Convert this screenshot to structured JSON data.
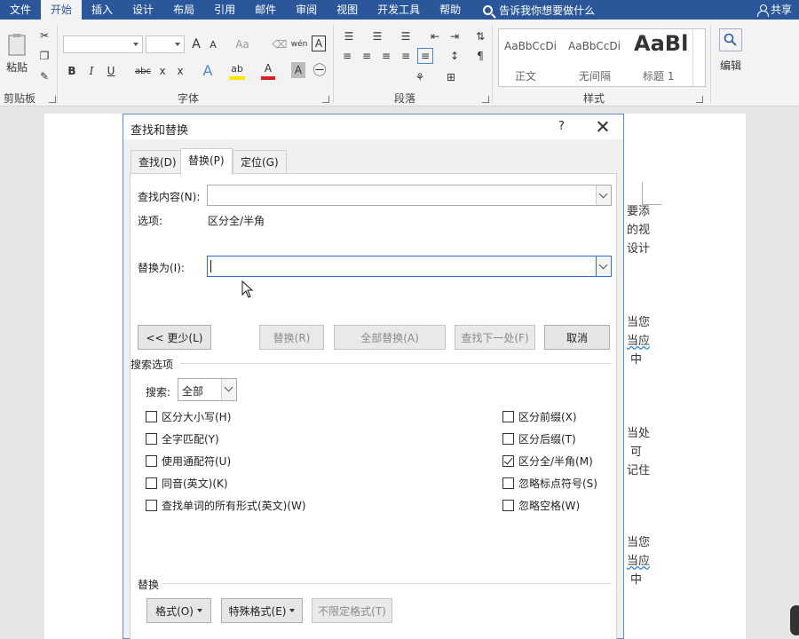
{
  "ribbon_tabs": [
    "文件",
    "开始",
    "插入",
    "设计",
    "布局",
    "引用",
    "邮件",
    "审阅",
    "视图",
    "开发工具",
    "帮助"
  ],
  "active_tab": "开始",
  "tell_me": "告诉我你想要做什么",
  "share": "共享",
  "ribbon": {
    "paste": "粘贴",
    "edit": "编辑",
    "groups": {
      "clipboard": "剪贴板",
      "font": "字体",
      "paragraph": "段落",
      "styles": "样式"
    },
    "font_icons": {
      "grow": "A",
      "shrink": "A",
      "clear": "Aa",
      "phonetic": "wén",
      "border_char": "A",
      "bold": "B",
      "italic": "I",
      "underline": "U",
      "strike": "abc",
      "sub": "x",
      "sup": "x",
      "effects": "A",
      "highlight": "ab",
      "color": "A",
      "shade": "A"
    },
    "styles": [
      {
        "sample": "AaBbCcDi",
        "name": "正文"
      },
      {
        "sample": "AaBbCcDi",
        "name": "无间隔"
      },
      {
        "sample": "AaBl",
        "name": "标题 1"
      }
    ]
  },
  "document": {
    "lines": [
      "要添",
      "的视",
      "设计",
      "当您",
      "当应",
      "中",
      "当处",
      "可",
      "记住",
      "当您",
      "当应",
      "中"
    ]
  },
  "dialog": {
    "title": "查找和替换",
    "help": "?",
    "tabs": [
      "查找(D)",
      "替换(P)",
      "定位(G)"
    ],
    "find_label": "查找内容(N):",
    "find_value": "",
    "options_label": "选项:",
    "options_value": "区分全/半角",
    "replace_label": "替换为(I):",
    "replace_value": "",
    "buttons": {
      "less": "<< 更少(L)",
      "replace": "替换(R)",
      "replace_all": "全部替换(A)",
      "find_next": "查找下一处(F)",
      "cancel": "取消"
    },
    "search_options_title": "搜索选项",
    "search_label": "搜索:",
    "search_value": "全部",
    "left_checks": [
      {
        "label": "区分大小写(H)",
        "checked": false
      },
      {
        "label": "全字匹配(Y)",
        "checked": false
      },
      {
        "label": "使用通配符(U)",
        "checked": false
      },
      {
        "label": "同音(英文)(K)",
        "checked": false
      },
      {
        "label": "查找单词的所有形式(英文)(W)",
        "checked": false
      }
    ],
    "right_checks": [
      {
        "label": "区分前缀(X)",
        "checked": false
      },
      {
        "label": "区分后缀(T)",
        "checked": false
      },
      {
        "label": "区分全/半角(M)",
        "checked": true
      },
      {
        "label": "忽略标点符号(S)",
        "checked": false
      },
      {
        "label": "忽略空格(W)",
        "checked": false
      }
    ],
    "replace_section": "替换",
    "bottom_buttons": {
      "format": "格式(O)",
      "special": "特殊格式(E)",
      "no_format": "不限定格式(T)"
    }
  },
  "colors": {
    "accent": "#2b579a",
    "dialog_border": "#5b8fd6"
  }
}
